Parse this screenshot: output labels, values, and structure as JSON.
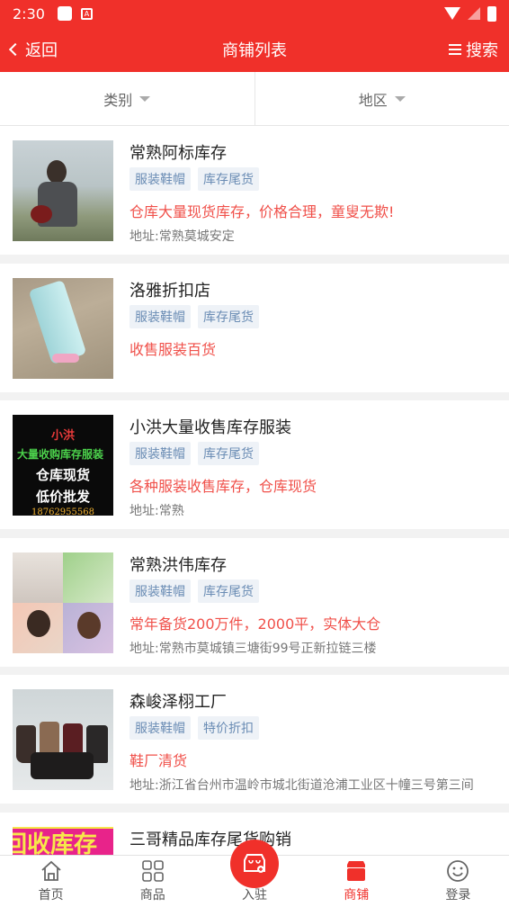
{
  "status": {
    "time": "2:30"
  },
  "nav": {
    "back_label": "返回",
    "title": "商铺列表",
    "search_label": "搜索"
  },
  "filters": [
    {
      "label": "类别"
    },
    {
      "label": "地区"
    }
  ],
  "shops": [
    {
      "name": "常熟阿标库存",
      "tags": [
        "服装鞋帽",
        "库存尾货"
      ],
      "desc": "仓库大量现货库存，价格合理，童叟无欺!",
      "addr": "地址:常熟莫城安定"
    },
    {
      "name": "洛雅折扣店",
      "tags": [
        "服装鞋帽",
        "库存尾货"
      ],
      "desc": "收售服装百货",
      "addr": ""
    },
    {
      "name": "小洪大量收售库存服装",
      "tags": [
        "服装鞋帽",
        "库存尾货"
      ],
      "desc": "各种服装收售库存，仓库现货",
      "addr": "地址:常熟",
      "thumb_text": {
        "line1": "小洪",
        "line2": "大量收购库存服装",
        "line3": "仓库现货",
        "line4": "低价批发",
        "line5": "18762955568"
      }
    },
    {
      "name": "常熟洪伟库存",
      "tags": [
        "服装鞋帽",
        "库存尾货"
      ],
      "desc": "常年备货200万件，2000平，实体大仓",
      "addr": "地址:常熟市莫城镇三塘街99号正新拉链三楼"
    },
    {
      "name": "森峻泽栩工厂",
      "tags": [
        "服装鞋帽",
        "特价折扣"
      ],
      "desc": "鞋厂清货",
      "addr": "地址:浙江省台州市温岭市城北街道沧浦工业区十幢三号第三间"
    },
    {
      "name": "三哥精品库存尾货购销",
      "tags": [],
      "desc": "",
      "addr": "",
      "thumb_text": {
        "line1": "回收库存"
      }
    }
  ],
  "tabbar": [
    {
      "label": "首页",
      "icon": "home-icon"
    },
    {
      "label": "商品",
      "icon": "grid-icon"
    },
    {
      "label": "入驻",
      "icon": "store-add-icon"
    },
    {
      "label": "商铺",
      "icon": "shop-icon",
      "active": true
    },
    {
      "label": "登录",
      "icon": "smile-icon"
    }
  ],
  "colors": {
    "primary": "#f0302a",
    "tag_bg": "#eef2f7",
    "tag_text": "#6a8cb4",
    "desc": "#f0504a"
  }
}
